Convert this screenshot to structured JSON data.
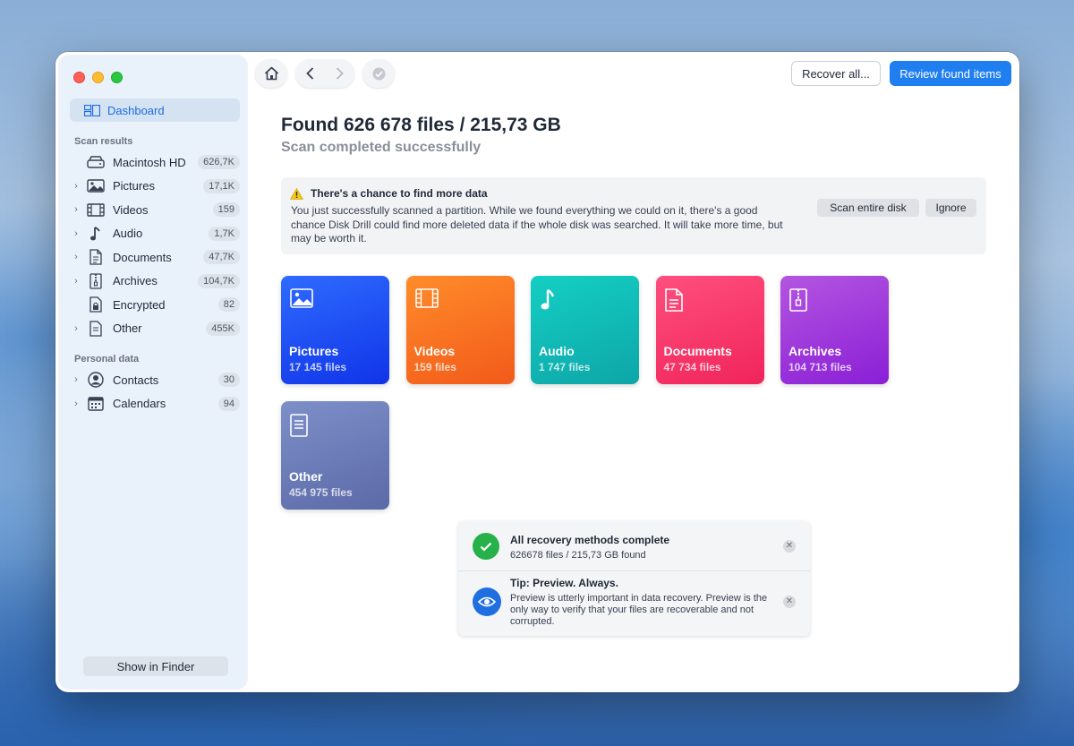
{
  "sidebar": {
    "dashboard_label": "Dashboard",
    "scan_results_label": "Scan results",
    "personal_data_label": "Personal data",
    "scan_items": [
      {
        "label": "Macintosh HD",
        "count": "626,7K",
        "icon": "hard-drive-icon",
        "expandable": false
      },
      {
        "label": "Pictures",
        "count": "17,1K",
        "icon": "picture-icon",
        "expandable": true
      },
      {
        "label": "Videos",
        "count": "159",
        "icon": "film-icon",
        "expandable": true
      },
      {
        "label": "Audio",
        "count": "1,7K",
        "icon": "music-note-icon",
        "expandable": true
      },
      {
        "label": "Documents",
        "count": "47,7K",
        "icon": "document-icon",
        "expandable": true
      },
      {
        "label": "Archives",
        "count": "104,7K",
        "icon": "archive-icon",
        "expandable": true
      },
      {
        "label": "Encrypted",
        "count": "82",
        "icon": "lock-document-icon",
        "expandable": false
      },
      {
        "label": "Other",
        "count": "455K",
        "icon": "file-icon",
        "expandable": true
      }
    ],
    "personal_items": [
      {
        "label": "Contacts",
        "count": "30",
        "icon": "contact-icon",
        "expandable": true
      },
      {
        "label": "Calendars",
        "count": "94",
        "icon": "calendar-icon",
        "expandable": true
      }
    ],
    "show_in_finder_label": "Show in Finder"
  },
  "toolbar": {
    "recover_all_label": "Recover all...",
    "review_label": "Review found items"
  },
  "main": {
    "title": "Found 626 678 files / 215,73 GB",
    "subtitle": "Scan completed successfully",
    "notice": {
      "heading": "There's a chance to find more data",
      "body": "You just successfully scanned a partition. While we found everything we could on it, there's a good chance Disk Drill could find more deleted data if the whole disk was searched. It will take more time, but may be worth it.",
      "scan_button": "Scan entire disk",
      "ignore_button": "Ignore"
    },
    "categories": [
      {
        "name": "Pictures",
        "count": "17 145 files",
        "icon": "picture-icon",
        "gradient": [
          "#2f6bff",
          "#1034e8"
        ]
      },
      {
        "name": "Videos",
        "count": "159 files",
        "icon": "film-icon",
        "gradient": [
          "#ff8c2a",
          "#f25a1a"
        ]
      },
      {
        "name": "Audio",
        "count": "1 747 files",
        "icon": "music-note-icon",
        "gradient": [
          "#14cfc4",
          "#0ea6a8"
        ]
      },
      {
        "name": "Documents",
        "count": "47 734 files",
        "icon": "document-icon",
        "gradient": [
          "#ff4f7e",
          "#f0245a"
        ]
      },
      {
        "name": "Archives",
        "count": "104 713 files",
        "icon": "archive-icon",
        "gradient": [
          "#b455e0",
          "#8a1fd6"
        ]
      },
      {
        "name": "Other",
        "count": "454 975 files",
        "icon": "file-icon",
        "gradient": [
          "#7d8fc9",
          "#5c6aa8"
        ]
      }
    ]
  },
  "notifications": [
    {
      "title": "All recovery methods complete",
      "text": "626678 files / 215,73 GB found",
      "icon": "check-circle-icon",
      "color": "#27b14a"
    },
    {
      "title": "Tip: Preview. Always.",
      "text": "Preview is utterly important in data recovery. Preview is the only way to verify that your files are recoverable and not corrupted.",
      "icon": "eye-icon",
      "color": "#1f6fe0"
    }
  ],
  "colors": {
    "accent": "#1f7ef0",
    "sidebar_bg": "#e9f1fb"
  }
}
